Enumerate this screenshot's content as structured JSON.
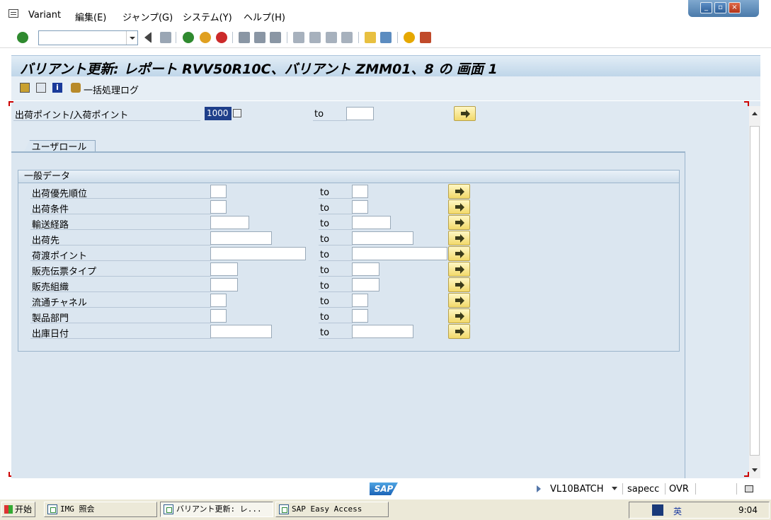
{
  "menu": {
    "items": [
      "Variant",
      "編集(E)",
      "ジャンプ(G)",
      "システム(Y)",
      "ヘルプ(H)"
    ]
  },
  "window": {
    "min": "_",
    "max": "▫",
    "close": "×"
  },
  "toolbar": {
    "command_value": ""
  },
  "title": "バリアント更新: レポート RVV50R10C、バリアント ZMM01、8 の 画面 1",
  "app_toolbar": {
    "batch_log_label": "一括処理ログ"
  },
  "header_field": {
    "label": "出荷ポイント/入荷ポイント",
    "from_value": "1000",
    "to_label": "to",
    "to_value": ""
  },
  "tab": {
    "label": "ユーザロール"
  },
  "group": {
    "title": "一般データ",
    "rows": [
      {
        "label": "出荷優先順位",
        "to": "to",
        "from_value": "",
        "to_value": ""
      },
      {
        "label": "出荷条件",
        "to": "to",
        "from_value": "",
        "to_value": ""
      },
      {
        "label": "輸送経路",
        "to": "to",
        "from_value": "",
        "to_value": ""
      },
      {
        "label": "出荷先",
        "to": "to",
        "from_value": "",
        "to_value": ""
      },
      {
        "label": "荷渡ポイント",
        "to": "to",
        "from_value": "",
        "to_value": ""
      },
      {
        "label": "販売伝票タイプ",
        "to": "to",
        "from_value": "",
        "to_value": ""
      },
      {
        "label": "販売組織",
        "to": "to",
        "from_value": "",
        "to_value": ""
      },
      {
        "label": "流通チャネル",
        "to": "to",
        "from_value": "",
        "to_value": ""
      },
      {
        "label": "製品部門",
        "to": "to",
        "from_value": "",
        "to_value": ""
      },
      {
        "label": "出庫日付",
        "to": "to",
        "from_value": "",
        "to_value": ""
      }
    ]
  },
  "status": {
    "logo": "SAP",
    "transaction": "VL10BATCH",
    "server": "sapecc",
    "mode": "OVR"
  },
  "taskbar": {
    "start": "开始",
    "tasks": [
      "IMG 照会",
      "バリアント更新: レ...",
      "SAP Easy Access"
    ],
    "ime": "英",
    "clock": "9:04"
  },
  "colors": {
    "frame_bg": "#dfe9f2",
    "title_bg": "#bfd6e9",
    "select_button": "#f2d96a",
    "taskbar": "#ece9d8"
  }
}
